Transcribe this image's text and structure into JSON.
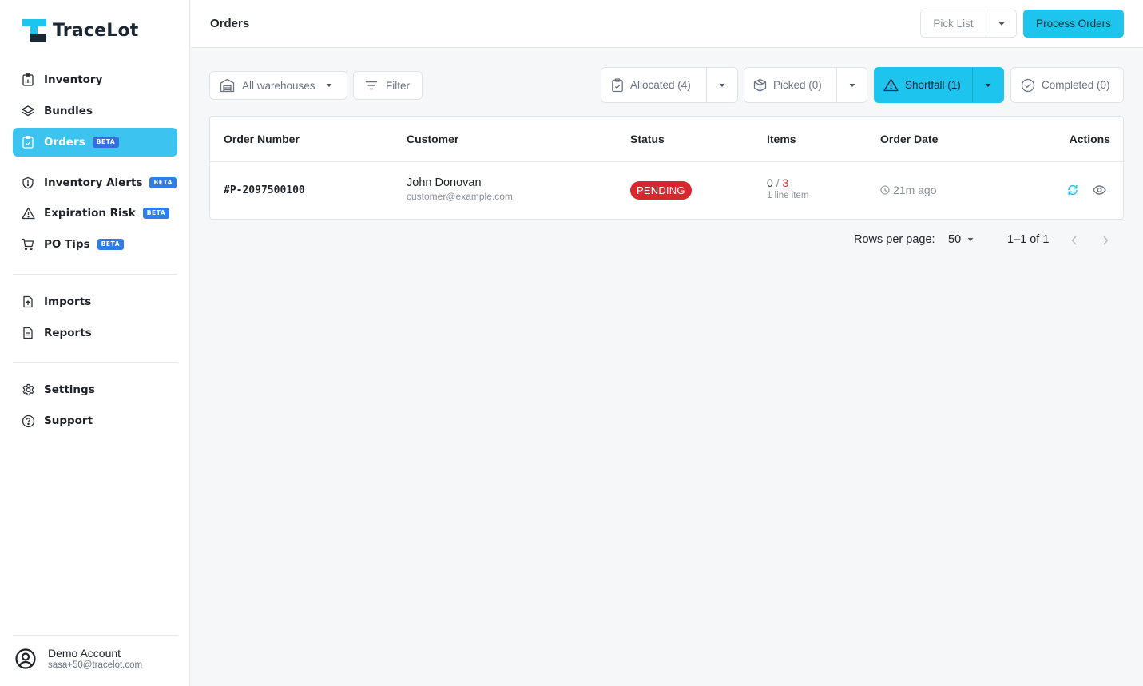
{
  "app": {
    "name": "TraceLot"
  },
  "sidebar": {
    "items": [
      {
        "label": "Inventory",
        "icon": "inventory-icon"
      },
      {
        "label": "Bundles",
        "icon": "layers-icon"
      },
      {
        "label": "Orders",
        "icon": "clipboard-icon",
        "badge": "BETA",
        "active": true
      },
      {
        "label": "Inventory Alerts",
        "icon": "shield-alert-icon",
        "badge": "BETA"
      },
      {
        "label": "Expiration Risk",
        "icon": "warning-icon",
        "badge": "BETA"
      },
      {
        "label": "PO Tips",
        "icon": "cart-icon",
        "badge": "BETA"
      },
      {
        "label": "Imports",
        "icon": "file-upload-icon"
      },
      {
        "label": "Reports",
        "icon": "file-text-icon"
      },
      {
        "label": "Settings",
        "icon": "gear-icon"
      },
      {
        "label": "Support",
        "icon": "help-icon"
      }
    ],
    "account": {
      "name": "Demo Account",
      "email": "sasa+50@tracelot.com"
    }
  },
  "header": {
    "title": "Orders",
    "pick_list_label": "Pick List",
    "process_label": "Process Orders"
  },
  "filters": {
    "warehouse_label": "All warehouses",
    "filter_label": "Filter",
    "allocated_label": "Allocated (4)",
    "picked_label": "Picked (0)",
    "shortfall_label": "Shortfall (1)",
    "completed_label": "Completed (0)"
  },
  "table": {
    "columns": [
      "Order Number",
      "Customer",
      "Status",
      "Items",
      "Order Date",
      "Actions"
    ],
    "rows": [
      {
        "order_number": "#P-2097500100",
        "customer_name": "John Donovan",
        "customer_email": "customer@example.com",
        "status": "PENDING",
        "items_picked": "0",
        "items_separator": " / ",
        "items_total": "3",
        "items_sub": "1 line item",
        "order_date": "21m ago"
      }
    ]
  },
  "pagination": {
    "rows_per_page_label": "Rows per page:",
    "rows_per_page": "50",
    "range": "1–1 of 1"
  },
  "colors": {
    "accent": "#1cc4ee",
    "active_nav": "#3cc3ef",
    "beta_badge": "#2e7de9",
    "danger": "#d7282f",
    "dark": "#1b2735"
  }
}
